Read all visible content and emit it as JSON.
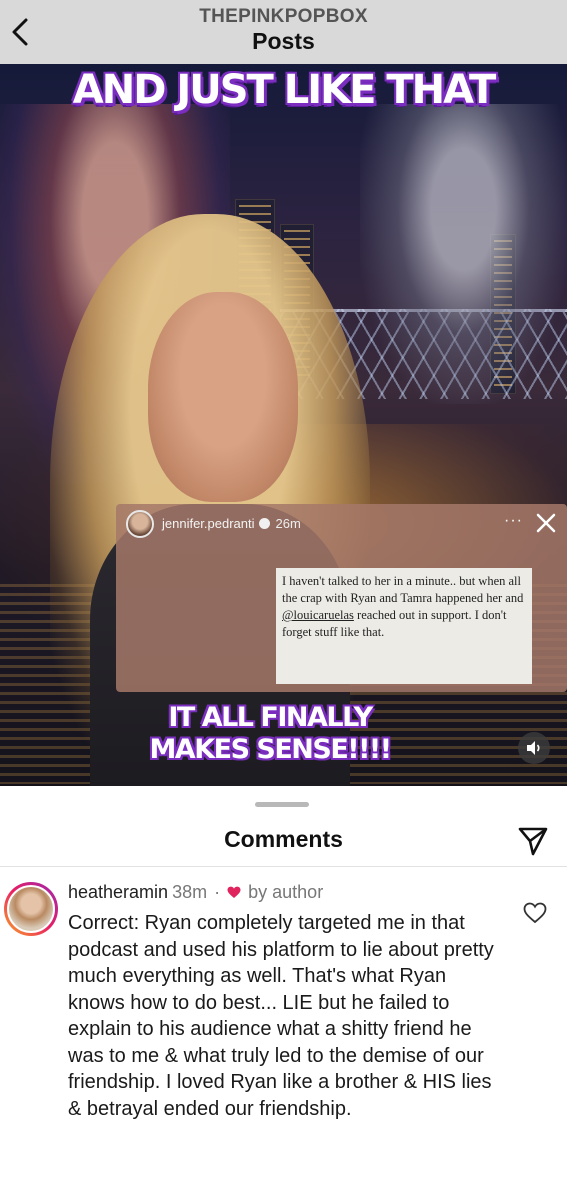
{
  "header": {
    "username": "THEPINKPOPBOX",
    "title": "Posts"
  },
  "post": {
    "headline_top": "AND JUST LIKE THAT",
    "headline_bottom_line1": "IT ALL FINALLY",
    "headline_bottom_line2": "MAKES SENSE!!!!",
    "story": {
      "username": "jennifer.pedranti",
      "time": "26m",
      "more": "···",
      "quote_before_mention": "I haven't talked to her in a minute.. but when all the crap with Ryan and Tamra happened her and ",
      "mention": "@louicaruelas",
      "quote_after_mention": " reached out in support. I don't forget stuff like that."
    }
  },
  "comments_sheet": {
    "title": "Comments",
    "comments": [
      {
        "username": "heatheramin",
        "time": "38m",
        "separator": "·",
        "author_like_label": "by author",
        "text": "Correct: Ryan completely targeted me in that podcast and used his platform to lie about pretty much everything as well. That's what Ryan knows how to do best... LIE  but he failed to explain to his audience what a shitty friend he was to me & what truly led to the demise of our friendship. I loved Ryan like a brother & HIS lies & betrayal ended our friendship."
      }
    ]
  },
  "colors": {
    "headline_outline": "#7a2dbf",
    "header_bg": "#d9d9d9",
    "author_heart": "#e0245e"
  },
  "icons": {
    "back": "chevron-left-icon",
    "audio": "speaker-icon",
    "close": "close-icon",
    "share": "paper-plane-icon",
    "like": "heart-outline-icon"
  }
}
